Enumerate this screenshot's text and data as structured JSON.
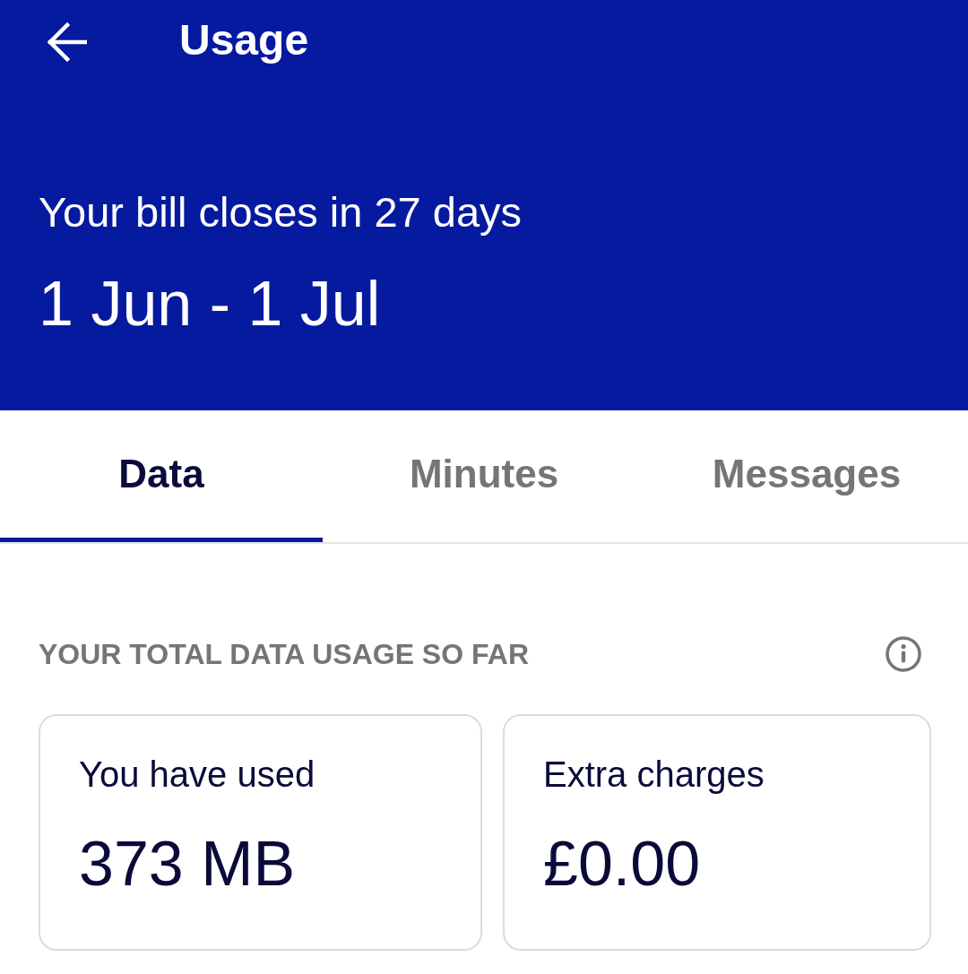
{
  "header": {
    "title": "Usage",
    "subtitle": "Your bill closes in 27 days",
    "period": "1 Jun - 1 Jul"
  },
  "tabs": [
    {
      "label": "Data",
      "selected": true
    },
    {
      "label": "Minutes",
      "selected": false
    },
    {
      "label": "Messages",
      "selected": false
    }
  ],
  "section": {
    "heading": "YOUR TOTAL DATA USAGE SO FAR"
  },
  "cards": [
    {
      "label": "You have used",
      "value": "373 MB"
    },
    {
      "label": "Extra charges",
      "value": "£0.00"
    }
  ]
}
